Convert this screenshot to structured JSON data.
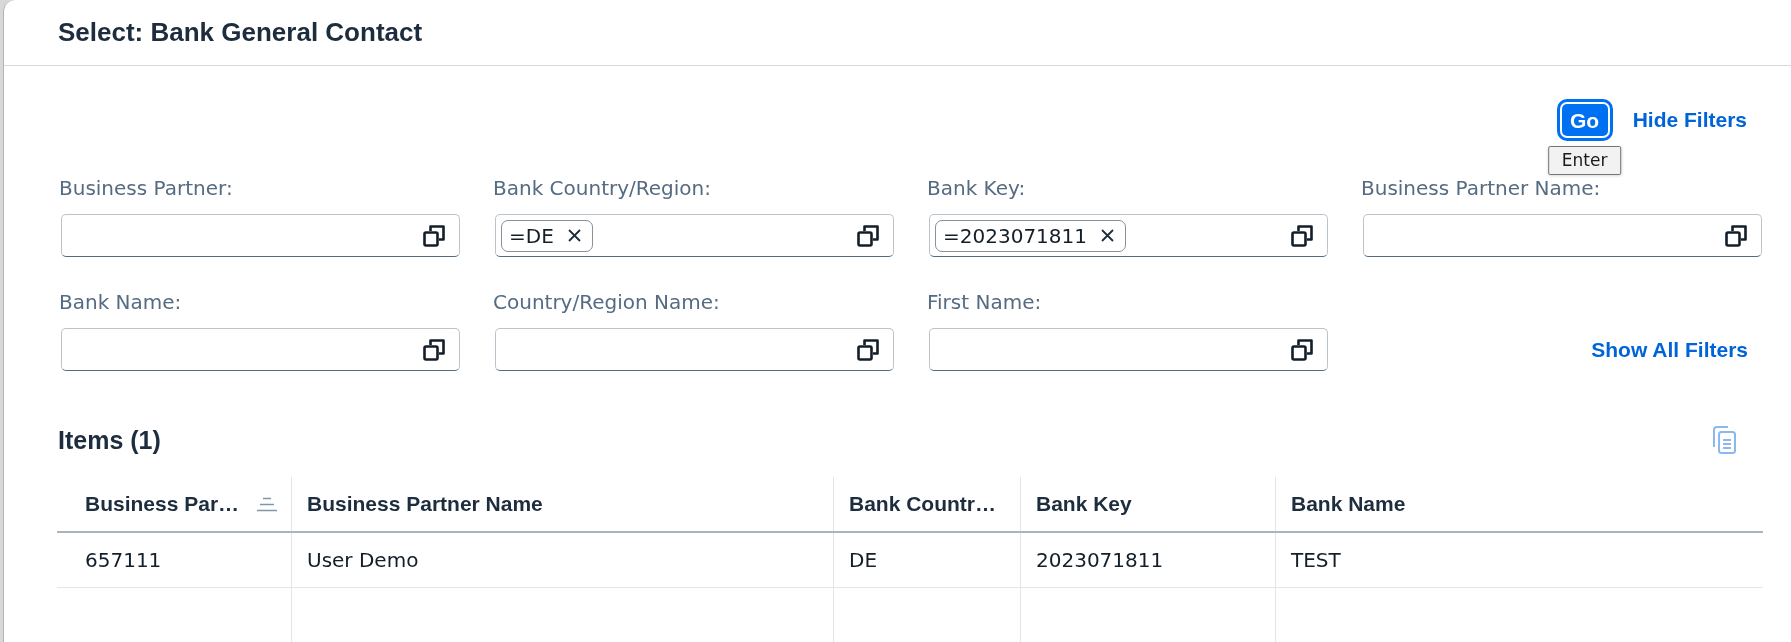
{
  "dialog": {
    "title": "Select: Bank General Contact"
  },
  "filter_bar": {
    "go_button": {
      "label": "Go",
      "focused": true
    },
    "tooltip": "Enter",
    "hide_filters": "Hide Filters",
    "filters": [
      {
        "label": "Business Partner:"
      },
      {
        "label": "Bank Country/Region:",
        "tokens": [
          "=DE"
        ]
      },
      {
        "label": "Bank Key:",
        "tokens": [
          "=2023071811"
        ]
      },
      {
        "label": "Business Partner Name:"
      },
      {
        "label": "Bank Name:"
      },
      {
        "label": "Country/Region Name:"
      },
      {
        "label": "First Name:"
      }
    ],
    "show_all_filters": "Show All Filters"
  },
  "table": {
    "title": "Items (1)",
    "copy_button": {
      "disabled": true
    },
    "columns": [
      {
        "label": "Business Par…",
        "sorted": true
      },
      {
        "label": "Business Partner Name",
        "sorted": false
      },
      {
        "label": "Bank Countr…",
        "sorted": false
      },
      {
        "label": "Bank Key",
        "sorted": false
      },
      {
        "label": "Bank Name",
        "sorted": false
      }
    ],
    "rows": [
      {
        "cells": [
          "657111",
          "User Demo",
          "DE",
          "2023071811",
          "TEST"
        ]
      }
    ]
  }
}
